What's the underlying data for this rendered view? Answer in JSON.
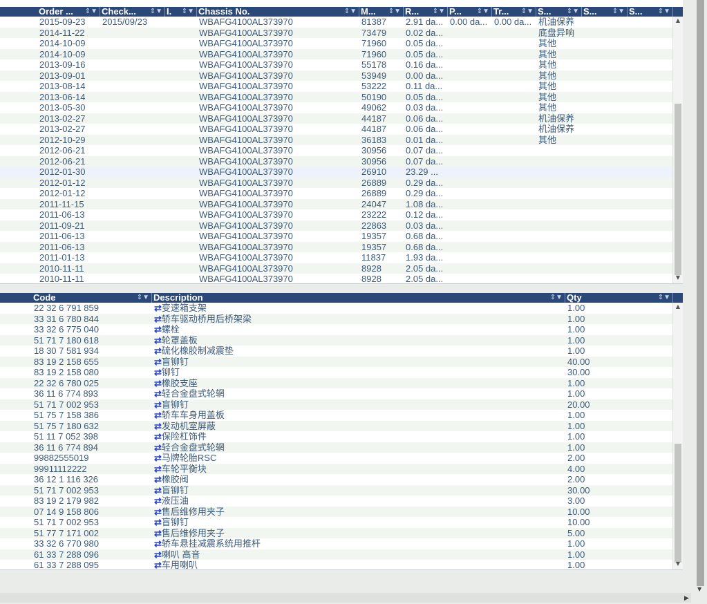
{
  "orders_table": {
    "headers": [
      "Order ...",
      "Check...",
      "I.",
      "Chassis No.",
      "M...",
      "R...",
      "P...",
      "Tr...",
      "S...",
      "S...",
      "S..."
    ],
    "rows": [
      [
        "2015-09-23",
        "2015/09/23",
        "",
        "WBAFG4100AL373970",
        "81387",
        "2.91 da...",
        "0.00 da...",
        "0.00 da...",
        "机油保养",
        "",
        ""
      ],
      [
        "2014-11-22",
        "",
        "",
        "WBAFG4100AL373970",
        "73479",
        "0.02 da...",
        "",
        "",
        "底盘异响",
        "",
        ""
      ],
      [
        "2014-10-09",
        "",
        "",
        "WBAFG4100AL373970",
        "71960",
        "0.05 da...",
        "",
        "",
        "其他",
        "",
        ""
      ],
      [
        "2014-10-09",
        "",
        "",
        "WBAFG4100AL373970",
        "71960",
        "0.05 da...",
        "",
        "",
        "其他",
        "",
        ""
      ],
      [
        "2013-09-16",
        "",
        "",
        "WBAFG4100AL373970",
        "55178",
        "0.16 da...",
        "",
        "",
        "其他",
        "",
        ""
      ],
      [
        "2013-09-01",
        "",
        "",
        "WBAFG4100AL373970",
        "53949",
        "0.00 da...",
        "",
        "",
        "其他",
        "",
        ""
      ],
      [
        "2013-08-14",
        "",
        "",
        "WBAFG4100AL373970",
        "53222",
        "0.11 da...",
        "",
        "",
        "其他",
        "",
        ""
      ],
      [
        "2013-06-14",
        "",
        "",
        "WBAFG4100AL373970",
        "50190",
        "0.05 da...",
        "",
        "",
        "其他",
        "",
        ""
      ],
      [
        "2013-05-30",
        "",
        "",
        "WBAFG4100AL373970",
        "49062",
        "0.03 da...",
        "",
        "",
        "其他",
        "",
        ""
      ],
      [
        "2013-02-27",
        "",
        "",
        "WBAFG4100AL373970",
        "44187",
        "0.06 da...",
        "",
        "",
        "机油保养",
        "",
        ""
      ],
      [
        "2013-02-27",
        "",
        "",
        "WBAFG4100AL373970",
        "44187",
        "0.06 da...",
        "",
        "",
        "机油保养",
        "",
        ""
      ],
      [
        "2012-10-29",
        "",
        "",
        "WBAFG4100AL373970",
        "36183",
        "0.01 da...",
        "",
        "",
        "其他",
        "",
        ""
      ],
      [
        "2012-06-21",
        "",
        "",
        "WBAFG4100AL373970",
        "30956",
        "0.07 da...",
        "",
        "",
        "",
        "",
        ""
      ],
      [
        "2012-06-21",
        "",
        "",
        "WBAFG4100AL373970",
        "30956",
        "0.07 da...",
        "",
        "",
        "",
        "",
        ""
      ],
      [
        "2012-01-30",
        "",
        "",
        "WBAFG4100AL373970",
        "26910",
        "23.29 ...",
        "",
        "",
        "",
        "",
        ""
      ],
      [
        "2012-01-12",
        "",
        "",
        "WBAFG4100AL373970",
        "26889",
        "0.29 da...",
        "",
        "",
        "",
        "",
        ""
      ],
      [
        "2012-01-12",
        "",
        "",
        "WBAFG4100AL373970",
        "26889",
        "0.29 da...",
        "",
        "",
        "",
        "",
        ""
      ],
      [
        "2011-11-15",
        "",
        "",
        "WBAFG4100AL373970",
        "24047",
        "1.08 da...",
        "",
        "",
        "",
        "",
        ""
      ],
      [
        "2011-06-13",
        "",
        "",
        "WBAFG4100AL373970",
        "23222",
        "0.12 da...",
        "",
        "",
        "",
        "",
        ""
      ],
      [
        "2011-09-21",
        "",
        "",
        "WBAFG4100AL373970",
        "22863",
        "0.03 da...",
        "",
        "",
        "",
        "",
        ""
      ],
      [
        "2011-06-13",
        "",
        "",
        "WBAFG4100AL373970",
        "19357",
        "0.68 da...",
        "",
        "",
        "",
        "",
        ""
      ],
      [
        "2011-06-13",
        "",
        "",
        "WBAFG4100AL373970",
        "19357",
        "0.68 da...",
        "",
        "",
        "",
        "",
        ""
      ],
      [
        "2011-01-13",
        "",
        "",
        "WBAFG4100AL373970",
        "11837",
        "1.93 da...",
        "",
        "",
        "",
        "",
        ""
      ],
      [
        "2010-11-11",
        "",
        "",
        "WBAFG4100AL373970",
        "8928",
        "2.05 da...",
        "",
        "",
        "",
        "",
        ""
      ],
      [
        "2010-11-11",
        "",
        "",
        "WBAFG4100AL373970",
        "8928",
        "2.05 da...",
        "",
        "",
        "",
        "",
        ""
      ]
    ]
  },
  "parts_table": {
    "headers": [
      "Code",
      "Description",
      "Qty"
    ],
    "rows": [
      [
        "22 32 6 791 859",
        "变速箱支架",
        "1.00"
      ],
      [
        "33 31 6 780 844",
        "轿车驱动桥用后桥架梁",
        "1.00"
      ],
      [
        "33 32 6 775 040",
        "螺栓",
        "1.00"
      ],
      [
        "51 71 7 180 618",
        "轮罩盖板",
        "1.00"
      ],
      [
        "18 30 7 581 934",
        "硫化橡胶制减震垫",
        "1.00"
      ],
      [
        "83 19 2 158 655",
        "盲铆钉",
        "40.00"
      ],
      [
        "83 19 2 158 080",
        "铆钉",
        "30.00"
      ],
      [
        "22 32 6 780 025",
        "橡胶支座",
        "1.00"
      ],
      [
        "36 11 6 774 893",
        "轻合金盘式轮辋",
        "1.00"
      ],
      [
        "51 71 7 002 953",
        "盲铆钉",
        "20.00"
      ],
      [
        "51 75 7 158 386",
        "轿车车身用盖板",
        "1.00"
      ],
      [
        "51 75 7 180 632",
        "发动机室屏蔽",
        "1.00"
      ],
      [
        "51 11 7 052 398",
        "保险杠饰件",
        "1.00"
      ],
      [
        "36 11 6 774 894",
        "轻合金盘式轮辋",
        "1.00"
      ],
      [
        "99882555019",
        "马牌轮胎RSC",
        "2.00"
      ],
      [
        "99911112222",
        "车轮平衡块",
        "4.00"
      ],
      [
        "36 12 1 116 326",
        "橡胶阀",
        "2.00"
      ],
      [
        "51 71 7 002 953",
        "盲铆钉",
        "30.00"
      ],
      [
        "83 19 2 179 982",
        "液压油",
        "3.00"
      ],
      [
        "07 14 9 158 806",
        "售后维修用夹子",
        "10.00"
      ],
      [
        "51 71 7 002 953",
        "盲铆钉",
        "10.00"
      ],
      [
        "51 77 7 171 002",
        "售后维修用夹子",
        "5.00"
      ],
      [
        "33 32 6 770 980",
        "轿车悬挂减震系统用推杆",
        "1.00"
      ],
      [
        "61 33 7 288 096",
        "喇叭 高音",
        "1.00"
      ],
      [
        "61 33 7 288 095",
        "车用喇叭",
        "1.00"
      ]
    ]
  },
  "icons": {
    "sort_filter": "sort-filter-icon",
    "substitute": "substitute-arrows-icon",
    "scroll_up": "scroll-up-arrow-icon",
    "scroll_down": "scroll-down-arrow-icon",
    "scroll_right": "scroll-right-arrow-icon"
  },
  "colors": {
    "header_bg": "#2a4878",
    "row_text": "#3c5a7a",
    "alt_row": "#f1f6f1",
    "selected_row": "#eef3fb",
    "link_arrow": "#2640c8"
  }
}
